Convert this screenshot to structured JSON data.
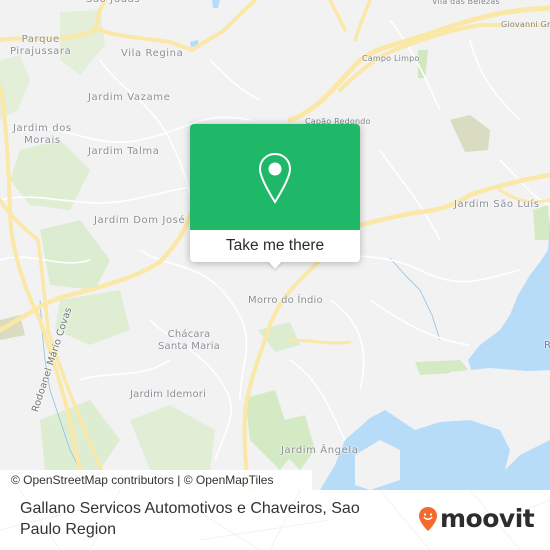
{
  "map": {
    "colors": {
      "land": "#f2f2f3",
      "road_major": "#fbe7a6",
      "road_minor": "#ffffff",
      "park": "#d6eac8",
      "park_dark": "#d9dcc0",
      "water": "#b6dcf8",
      "label": "#8a8f96"
    },
    "place_labels": [
      {
        "id": "sao-judas",
        "text": "São Judas"
      },
      {
        "id": "parque-pirajussara",
        "text": "Parque\nPirajussara"
      },
      {
        "id": "vila-regina",
        "text": "Vila Regina"
      },
      {
        "id": "vila-das-belezas",
        "text": "Vila das Belezas"
      },
      {
        "id": "giovanni-gronchi",
        "text": "Giovanni Gro"
      },
      {
        "id": "campo-limpo",
        "text": "Campo Limpo"
      },
      {
        "id": "jardim-vazame",
        "text": "Jardim Vazame"
      },
      {
        "id": "capao-redondo",
        "text": "Capão Redondo"
      },
      {
        "id": "jardim-dos-morais",
        "text": "Jardim dos\nMorais"
      },
      {
        "id": "jardim-talma",
        "text": "Jardim Talma"
      },
      {
        "id": "jardim-dom-jose",
        "text": "Jardim Dom José"
      },
      {
        "id": "jardim-sao-luis",
        "text": "Jardim São Luís"
      },
      {
        "id": "morro-do-indio",
        "text": "Morro do Índio"
      },
      {
        "id": "chacara-santa-maria",
        "text": "Chácara\nSanta Maria"
      },
      {
        "id": "jardim-idemori",
        "text": "Jardim Idemori"
      },
      {
        "id": "jardim-angela",
        "text": "Jardim Ângela"
      },
      {
        "id": "rodoanel",
        "text": "Rodoanel Mário Covas"
      },
      {
        "id": "edge-r",
        "text": "R"
      }
    ],
    "attribution": "© OpenStreetMap contributors | © OpenMapTiles"
  },
  "popup": {
    "icon": "location-pin-icon",
    "accent": "#1eb868",
    "button_label": "Take me there"
  },
  "footer": {
    "title": "Gallano Servicos Automotivos e Chaveiros, Sao Paulo Region",
    "logo": {
      "text": "moovit",
      "icon": "moovit-smile-pin-icon",
      "accent": "#f26a2e"
    }
  }
}
